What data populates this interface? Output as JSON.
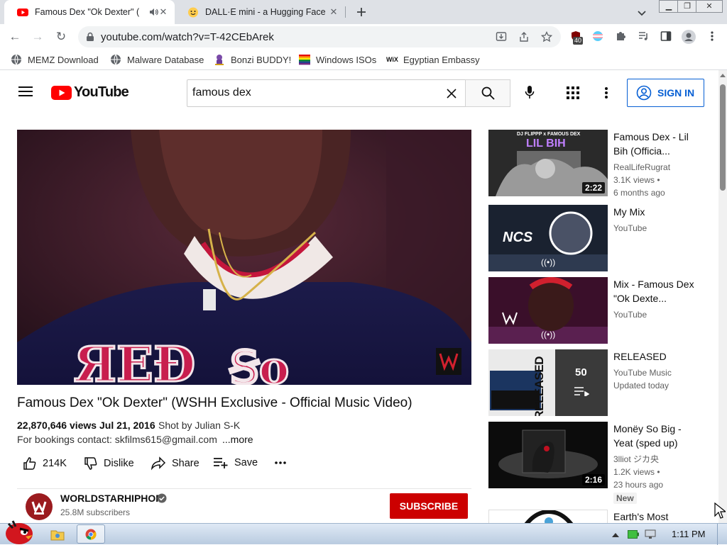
{
  "browser": {
    "tabs": [
      {
        "title": "Famous Dex \"Ok Dexter\" (",
        "active": true
      },
      {
        "title": "DALL·E mini - a Hugging Face",
        "active": false
      }
    ],
    "new_tab_icon": "plus-icon",
    "address": "youtube.com/watch?v=T-42CEbArek",
    "extension_badge": "40",
    "bookmarks": [
      {
        "label": "MEMZ Download",
        "icon": "globe-icon"
      },
      {
        "label": "Malware Database",
        "icon": "globe-icon"
      },
      {
        "label": "Bonzi BUDDY!",
        "icon": "bonzi-icon"
      },
      {
        "label": "Windows ISOs",
        "icon": "windows-flag-icon"
      },
      {
        "label": "Egyptian Embassy",
        "icon": "wix-icon"
      }
    ]
  },
  "youtube": {
    "logo": "YouTube",
    "search_query": "famous dex",
    "sign_in": "SIGN IN",
    "video": {
      "title": "Famous Dex \"Ok Dexter\" (WSHH Exclusive - Official Music Video)",
      "views": "22,870,646 views",
      "date": "Jul 21, 2016",
      "shot_by": "Shot by Julian S-K",
      "description": "For bookings contact: skfilms615@gmail.com",
      "more": "...more",
      "likes": "214K",
      "dislike": "Dislike",
      "share": "Share",
      "save": "Save"
    },
    "channel": {
      "name": "WORLDSTARHIPHOP",
      "subscribers": "25.8M subscribers",
      "subscribe": "SUBSCRIBE"
    },
    "recommendations": [
      {
        "title": "Famous Dex - Lil Bih (Officia...",
        "channel": "RealLifeRugrat",
        "views": "3.1K views •",
        "age": "6 months ago",
        "duration": "2:22",
        "thumb_text": "LIL BIH",
        "thumb_top": "DJ FLIPPP x FAMOUS DEX"
      },
      {
        "title": "My Mix",
        "channel": "YouTube",
        "thumb_text": "NCS",
        "live_icon": "((•))"
      },
      {
        "title": "Mix - Famous Dex \"Ok Dexte...",
        "channel": "YouTube",
        "live_icon": "((•))"
      },
      {
        "title": "RELEASED",
        "channel": "YouTube Music",
        "updated": "Updated today",
        "count": "50",
        "thumb_text": "RELEASED"
      },
      {
        "title": "Monëy So Big - Yeat (sped up)",
        "channel": "3lliot ジカ央",
        "views": "1.2K views •",
        "age": "23 hours ago",
        "duration": "2:16",
        "badge": "New"
      },
      {
        "title": "Earth's Most"
      }
    ]
  },
  "taskbar": {
    "clock": "1:11 PM"
  },
  "colors": {
    "youtube_red": "#ff0000",
    "subscribe_red": "#cc0000",
    "link_blue": "#065fd4"
  }
}
